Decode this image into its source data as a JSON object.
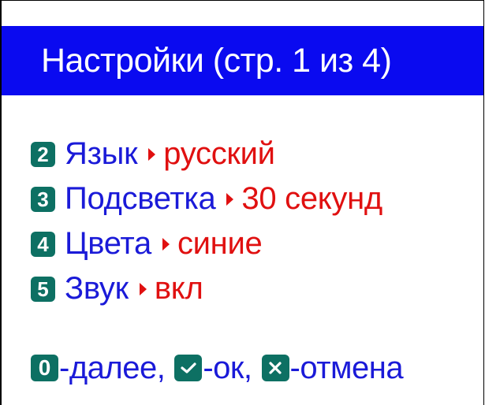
{
  "colors": {
    "title_bar_bg": "#0a0af0",
    "title_text": "#ffffff",
    "label_text": "#1a1ad8",
    "value_text": "#e01010",
    "key_badge_bg": "#0d7063",
    "key_badge_text": "#ffffff"
  },
  "header": {
    "title": "Настройки (стр. 1 из 4)"
  },
  "menu": {
    "items": [
      {
        "key": "2",
        "label": "Язык",
        "arrow_icon": "triangle-right-icon",
        "value": "русский"
      },
      {
        "key": "3",
        "label": "Подсветка",
        "arrow_icon": "triangle-right-icon",
        "value": "30 секунд"
      },
      {
        "key": "4",
        "label": "Цвета",
        "arrow_icon": "triangle-right-icon",
        "value": "синие"
      },
      {
        "key": "5",
        "label": "Звук",
        "arrow_icon": "triangle-right-icon",
        "value": "вкл"
      }
    ]
  },
  "footer": {
    "next": {
      "key": "0",
      "text": "-далее,"
    },
    "ok": {
      "icon": "checkmark-icon",
      "text": "-ок,"
    },
    "cancel": {
      "icon": "cross-icon",
      "text": "-отмена"
    }
  }
}
